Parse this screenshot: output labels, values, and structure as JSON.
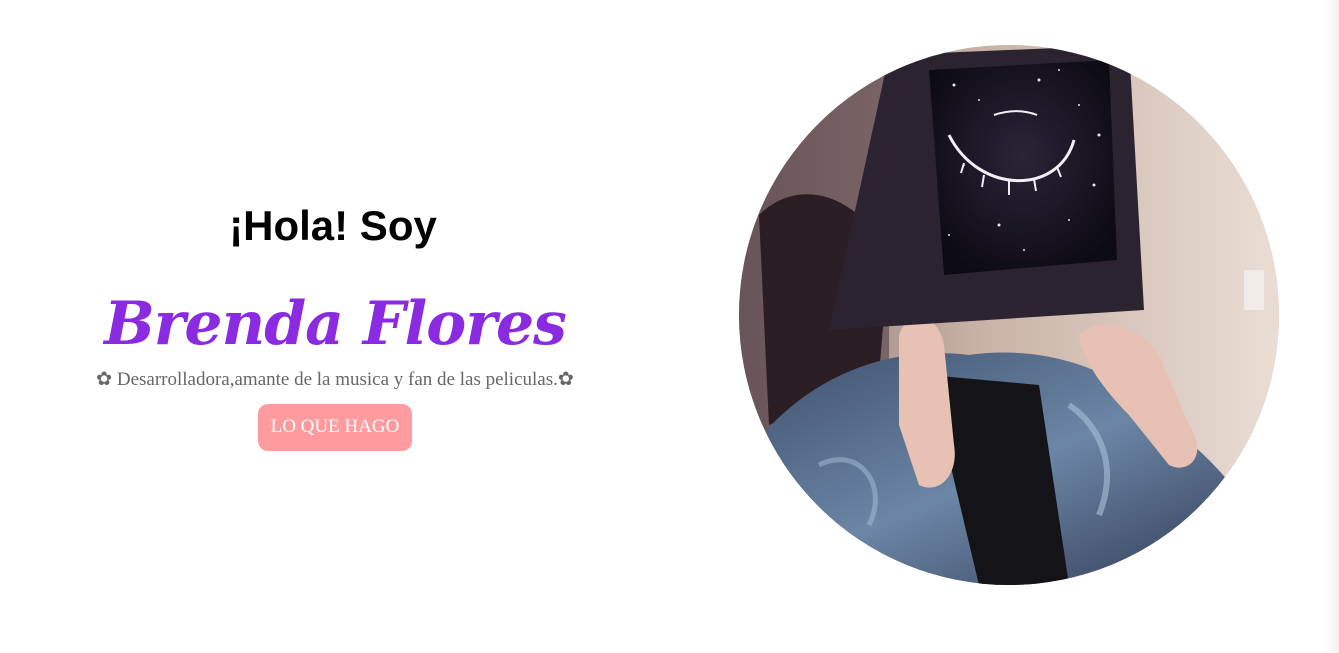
{
  "hero": {
    "greeting": "¡Hola! Soy",
    "name": "Brenda Flores",
    "tagline": "✿ Desarrolladora,amante de la musica y fan de las peliculas.✿",
    "cta_label": "LO QUE HAGO"
  },
  "colors": {
    "name": "#8a2be2",
    "cta_background": "#ff9a9e",
    "cta_text": "#ffffff",
    "tagline": "#666666"
  },
  "images": {
    "profile_photo": "profile-photo"
  }
}
